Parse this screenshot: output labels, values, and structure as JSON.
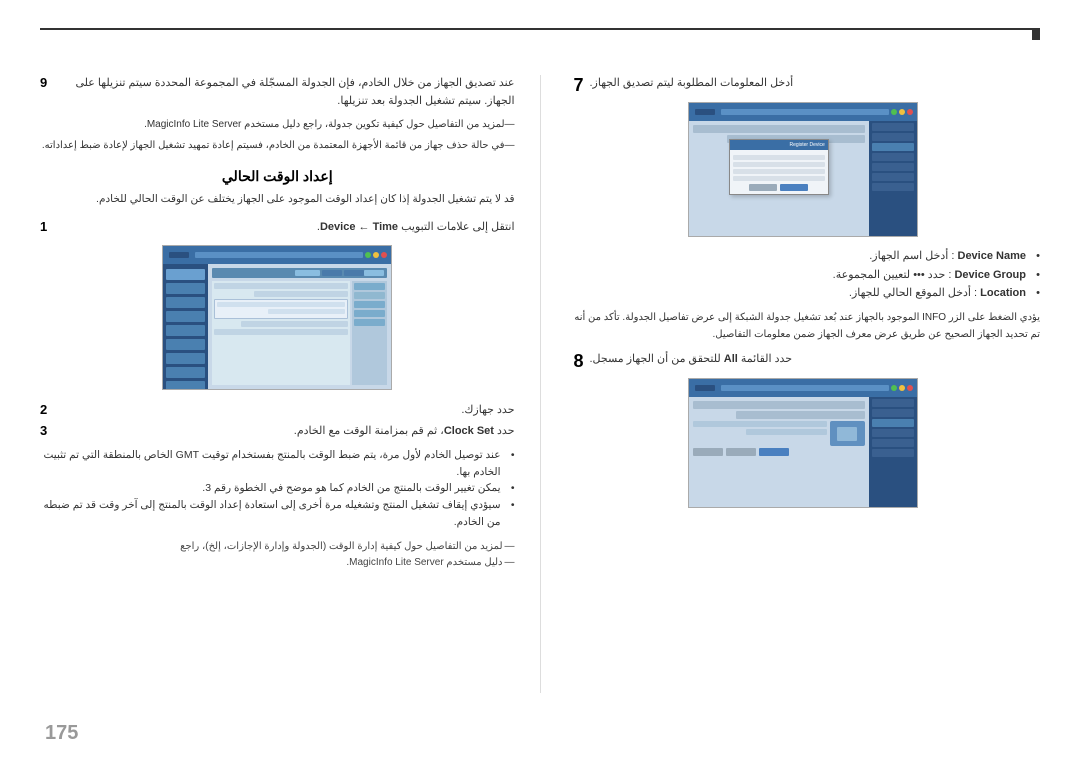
{
  "page": {
    "number": "175",
    "top_border": true
  },
  "left_column": {
    "section9": {
      "number": "9",
      "main_text": "عند تصديق الجهاز من خلال الخادم، فإن الجدولة المسجّلة في المجموعة المحددة سيتم تنزيلها على الجهاز. سيتم تشغيل الجدولة بعد تنزيلها.",
      "dashed1": "لمزيد من التفاصيل حول كيفية تكوين جدولة، راجع دليل مستخدم MagicInfo Lite Server.",
      "dashed2": "في حالة حذف جهاز من قائمة الأجهزة المعتمدة من الخادم، فسيتم إعادة تمهيد تشغيل الجهاز لإعادة ضبط إعداداته."
    },
    "heading_current_time": "إعداد الوقت الحالي",
    "current_time_desc": "قد لا يتم تشغيل الجدولة إذا كان إعداد الوقت الموجود على الجهاز يختلف عن الوقت الحالي للخادم.",
    "step1": {
      "number": "1",
      "text": "انتقل إلى علامات التبويب Device ← Time."
    },
    "step2": {
      "number": "2",
      "text": "حدد جهازك."
    },
    "step3": {
      "number": "3",
      "text_prefix": "حدد",
      "highlight": "Clock Set",
      "text_suffix": "، ثم قم بمزامنة الوقت مع الخادم."
    },
    "bullets": [
      "عند توصيل الخادم لأول مرة، يتم ضبط الوقت بالمنتج بفستخدام توقيت GMT الخاص بالمنطقة التي تم تثبيت الخادم بها.",
      "يمكن تغيير الوقت بالمنتج من الخادم كما هو موضح في الخطوة رقم 3.",
      "سيؤدي إيقاف تشغيل المنتج وتشغيله مرة أخرى إلى استعادة إعداد الوقت بالمنتج إلى آخر وقت قد تم ضبطه من الخادم."
    ],
    "dashed_bottom1": "لمزيد من التفاصيل حول كيفية إدارة الوقت (الجدولة وإدارة الإجازات، إلخ)، راجع",
    "dashed_bottom2": "دليل مستخدم MagicInfo Lite Server."
  },
  "right_column": {
    "section7": {
      "number": "7",
      "text": "أدخل المعلومات المطلوبة ليتم تصديق الجهاز."
    },
    "bullet_items": [
      {
        "term": "Device Name",
        "desc": ": أدخل اسم الجهاز."
      },
      {
        "term": "Device Group",
        "desc": ": حدد ••• لتعيين المجموعة."
      },
      {
        "term": "Location",
        "desc": ": أدخل الموقع الحالي للجهاز."
      }
    ],
    "info_text": "يؤدي الضغط على الزر INFO الموجود بالجهاز عند بُعد تشغيل جدولة الشبكة إلى عرض تفاصيل الجدولة. تأكد من أنه تم تحديد الجهاز الصحيح عن طريق عرض معرف الجهاز ضمن معلومات التفاصيل.",
    "section8": {
      "number": "8",
      "text": "حدد القائمة All للتحقق من أن الجهاز مسجل."
    }
  },
  "screenshot_toolbar_dots": [
    "red",
    "yellow",
    "green"
  ],
  "icons": {
    "bullet": "•",
    "dash": "—"
  }
}
